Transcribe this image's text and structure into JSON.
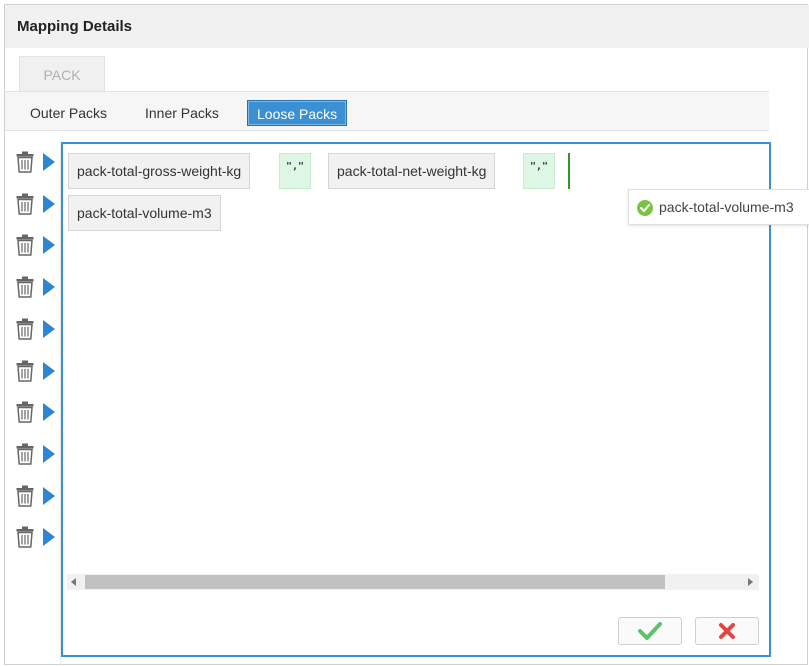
{
  "header": {
    "title": "Mapping Details"
  },
  "pack_tab": {
    "label": "PACK"
  },
  "subtabs": [
    {
      "label": "Outer Packs",
      "active": false
    },
    {
      "label": "Inner Packs",
      "active": false
    },
    {
      "label": "Loose Packs",
      "active": true
    }
  ],
  "rows_count": 10,
  "fields": {
    "row1": [
      {
        "type": "field",
        "text": "pack-total-gross-weight-kg"
      },
      {
        "type": "delimiter",
        "text": "\",\""
      },
      {
        "type": "field",
        "text": "pack-total-net-weight-kg"
      },
      {
        "type": "delimiter",
        "text": "\",\""
      }
    ],
    "row2": [
      {
        "type": "field",
        "text": "pack-total-volume-m3"
      }
    ]
  },
  "tooltip": {
    "text": "pack-total-volume-m3",
    "icon": "check-circle-icon"
  },
  "actions": {
    "confirm_icon": "check-icon",
    "cancel_icon": "close-icon"
  },
  "colors": {
    "accent": "#3b8fd3",
    "confirm": "#5cc36a",
    "cancel": "#e54540",
    "delimiter_bg": "#ddf7e4"
  }
}
